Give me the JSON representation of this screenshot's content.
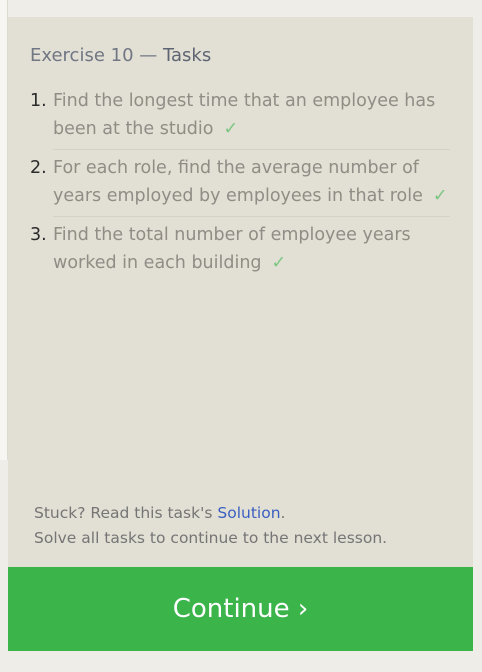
{
  "panel": {
    "title_prefix": "Exercise 10 — ",
    "title_tasks": "Tasks"
  },
  "tasks": [
    {
      "number": "1.",
      "text": "Find the longest time that an employee has been at the studio",
      "check": "✓"
    },
    {
      "number": "2.",
      "text": "For each role, find the average number of years employed by employees in that role",
      "check": "✓"
    },
    {
      "number": "3.",
      "text": "Find the total number of employee years worked in each building",
      "check": "✓"
    }
  ],
  "footer": {
    "stuck_prefix": "Stuck? Read this task's ",
    "solution_link": "Solution",
    "stuck_suffix": ".",
    "continue_note": "Solve all tasks to continue to the next lesson."
  },
  "continue_button": {
    "label": "Continue ›"
  },
  "colors": {
    "panel_bg": "#e2dfd4",
    "button_green": "#3bb44a",
    "check_green": "#7cc683",
    "link_blue": "#3a5fc0"
  }
}
